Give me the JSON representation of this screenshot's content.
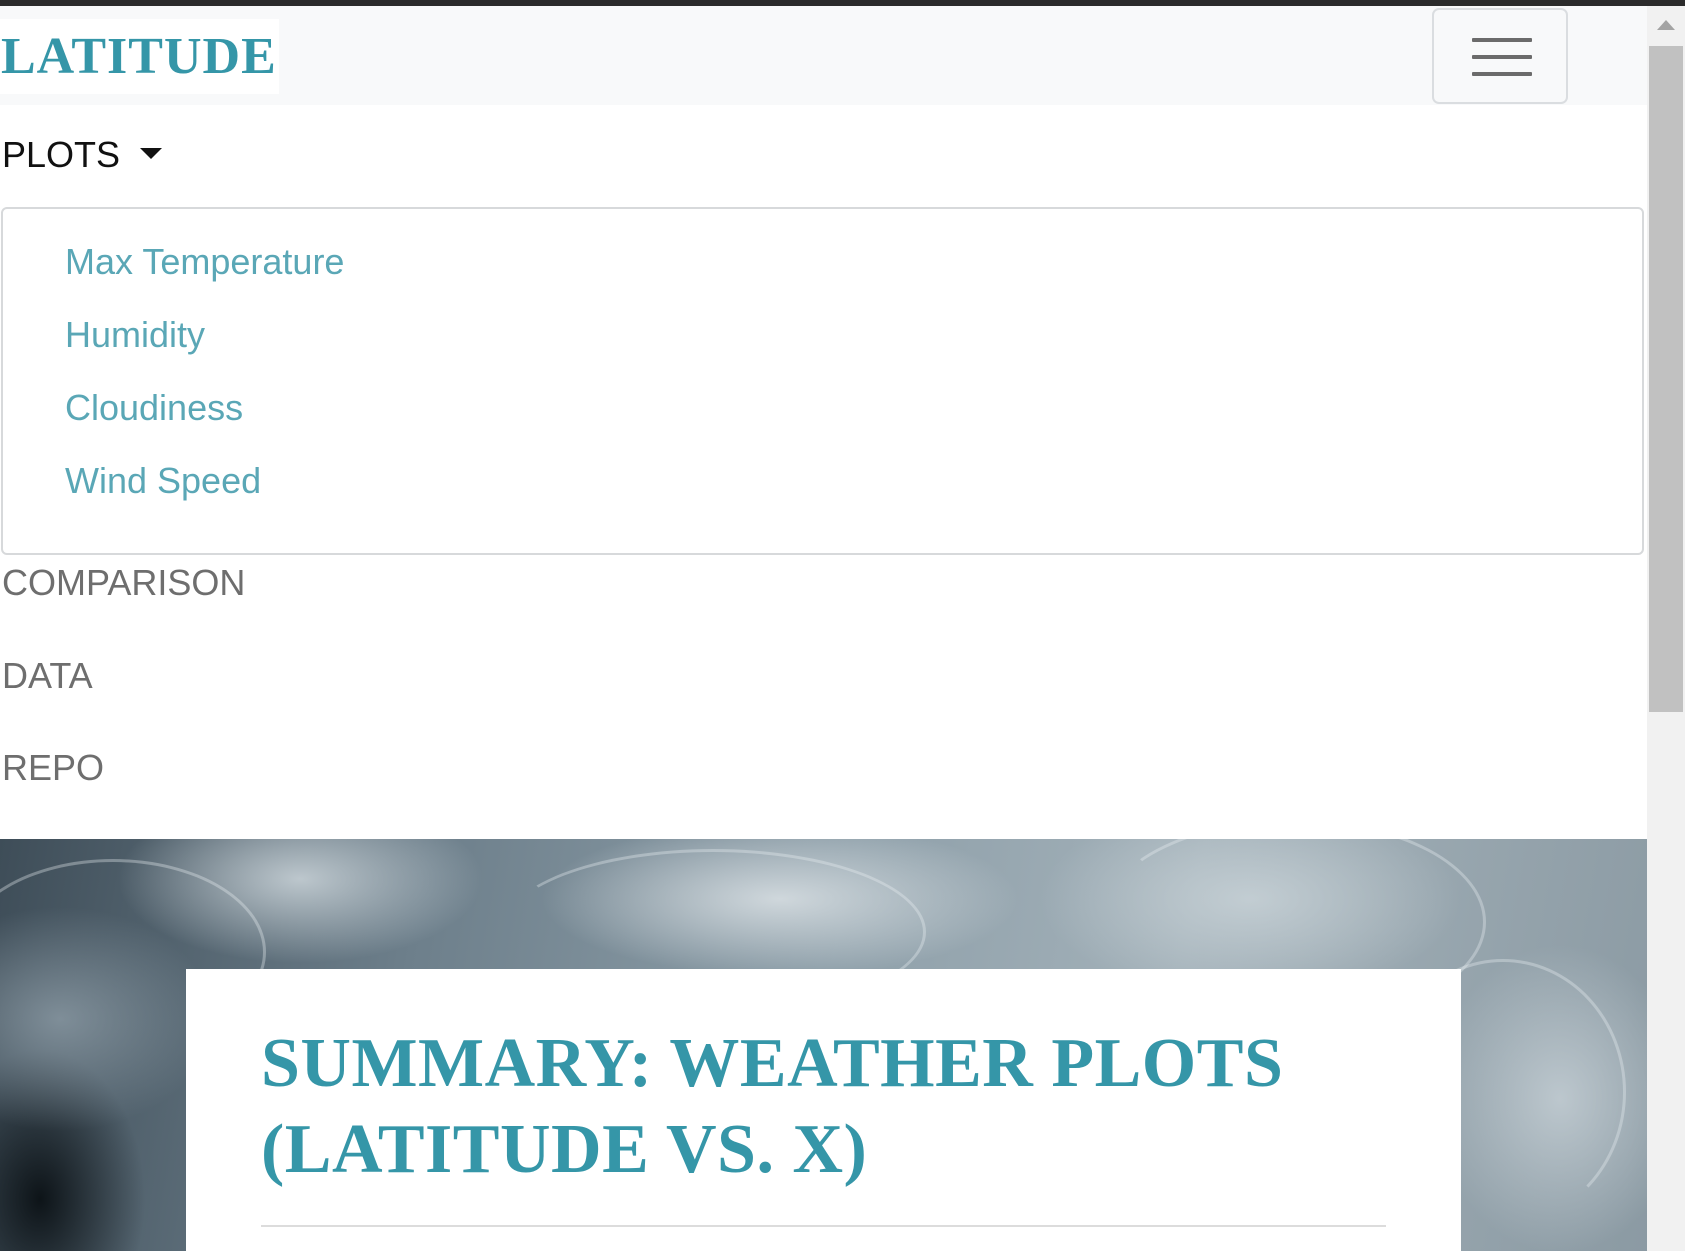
{
  "navbar": {
    "brand": "LATITUDE",
    "toggler_icon": "hamburger-menu-icon"
  },
  "nav": {
    "plots": {
      "label": "PLOTS",
      "caret_icon": "caret-down-icon",
      "items": [
        "Max Temperature",
        "Humidity",
        "Cloudiness",
        "Wind Speed"
      ]
    },
    "links": [
      "COMPARISON",
      "DATA",
      "REPO"
    ]
  },
  "hero": {
    "card_title_line1": "SUMMARY: WEATHER PLOTS",
    "card_title_line2": "(LATITUDE VS. X)"
  },
  "colors": {
    "accent": "#3596a8",
    "dropdown_item": "#5aa7b6",
    "nav_link": "#6e6e6e",
    "navbar_bg": "#f8f9fa"
  }
}
